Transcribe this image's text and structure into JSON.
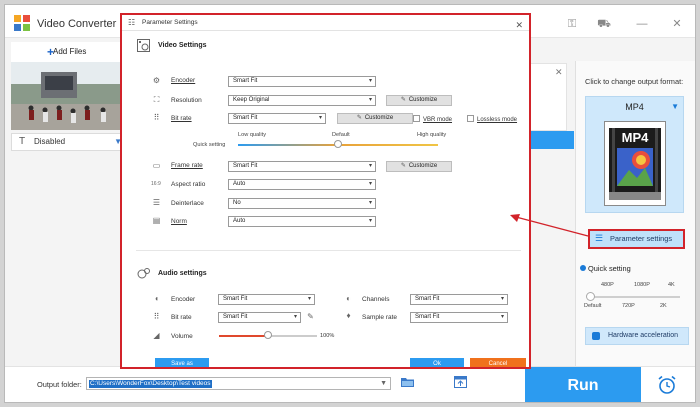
{
  "app": {
    "title": "Video Converter",
    "add_files": "Add Files",
    "subtitle_select": "Disabled"
  },
  "right_panel": {
    "format_prompt": "Click to change output format:",
    "format": "MP4",
    "format_icon_text": "MP4",
    "parameter_settings": "Parameter settings",
    "quick_setting": "Quick setting",
    "quick_labels_top": [
      "480P",
      "1080P",
      "4K"
    ],
    "quick_labels_bottom": [
      "Default",
      "720P",
      "2K"
    ],
    "quick_level": 0,
    "hardware_acceleration": "Hardware acceleration"
  },
  "bottom": {
    "output_label": "Output folder:",
    "output_path": "C:\\Users\\WonderFox\\Desktop\\Test videos",
    "run": "Run"
  },
  "dialog": {
    "title": "Parameter Settings",
    "video_section": "Video Settings",
    "audio_section": "Audio settings",
    "video": {
      "encoder_label": "Encoder",
      "encoder_value": "Smart Fit",
      "resolution_label": "Resolution",
      "resolution_value": "Keep Original",
      "bitrate_label": "Bit rate",
      "bitrate_value": "Smart Fit",
      "vbr_mode": "VBR mode",
      "lossless_mode": "Lossless mode",
      "quick_setting": "Quick setting",
      "low_quality": "Low quality",
      "default_quality": "Default",
      "high_quality": "High quality",
      "quality_level": 0.5,
      "framerate_label": "Frame rate",
      "framerate_value": "Smart Fit",
      "aspect_label": "Aspect ratio",
      "aspect_value": "Auto",
      "deinterlace_label": "Deinterlace",
      "deinterlace_value": "No",
      "norm_label": "Norm",
      "norm_value": "Auto",
      "customize": "Customize"
    },
    "audio": {
      "encoder_label": "Encoder",
      "encoder_value": "Smart Fit",
      "bitrate_label": "Bit rate",
      "bitrate_value": "Smart Fit",
      "volume_label": "Volume",
      "volume_value": "100%",
      "volume_level": 0.5,
      "channels_label": "Channels",
      "channels_value": "Smart Fit",
      "samplerate_label": "Sample rate",
      "samplerate_value": "Smart Fit"
    },
    "save_as": "Save as",
    "ok": "Ok",
    "cancel": "Cancel"
  },
  "colors": {
    "accent": "#2c9bf0",
    "highlight_border": "#d2232a",
    "cancel": "#f0711c"
  }
}
